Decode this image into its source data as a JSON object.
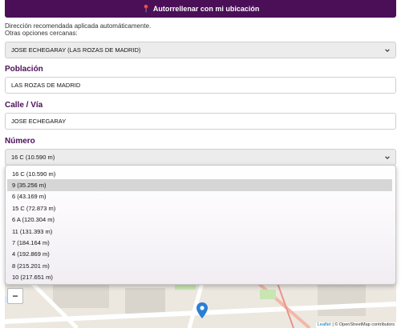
{
  "autofill_button": {
    "label": "Autorrellenar con mi ubicación",
    "icon": "map-pin-icon"
  },
  "recommendation": {
    "line1": "Dirección recomendada aplicada automáticamente.",
    "line2": "Otras opciones cercanas:"
  },
  "address_select": {
    "value": "JOSE ECHEGARAY (LAS ROZAS DE MADRID)"
  },
  "poblacion": {
    "label": "Población",
    "value": "LAS ROZAS DE MADRID"
  },
  "calle": {
    "label": "Calle / Vía",
    "value": "JOSE ECHEGARAY"
  },
  "numero": {
    "label": "Número",
    "value": "16 C (10.590 m)",
    "options": [
      "16 C (10.590 m)",
      "9 (35.256 m)",
      "6 (43.169 m)",
      "15 C (72.873 m)",
      "6 A (120.304 m)",
      "11 (131.393 m)",
      "7 (184.164 m)",
      "4 (192.869 m)",
      "8 (215.201 m)",
      "10 (217.651 m)"
    ],
    "highlighted_index": 1
  },
  "map": {
    "zoom_out_label": "−",
    "attribution_leaflet": "Leaflet",
    "attribution_osm": "| © OpenStreetMap contributors"
  },
  "colors": {
    "primary": "#4a0f57",
    "marker": "#2a7fd4"
  }
}
